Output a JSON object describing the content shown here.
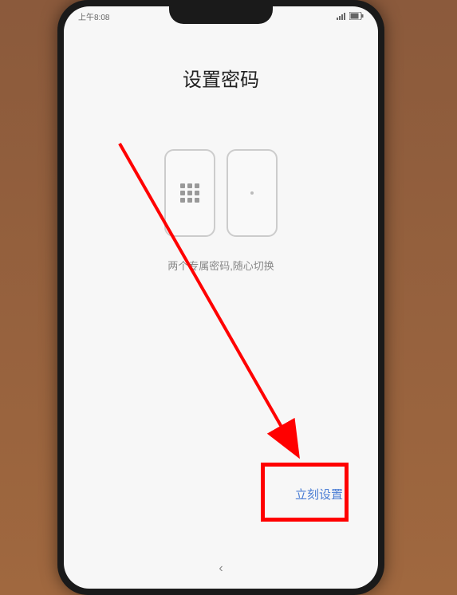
{
  "status_bar": {
    "time": "上午8:08"
  },
  "page": {
    "title": "设置密码",
    "description": "两个专属密码,随心切换"
  },
  "action": {
    "setup_now_label": "立刻设置"
  },
  "nav": {
    "back_glyph": "‹"
  }
}
